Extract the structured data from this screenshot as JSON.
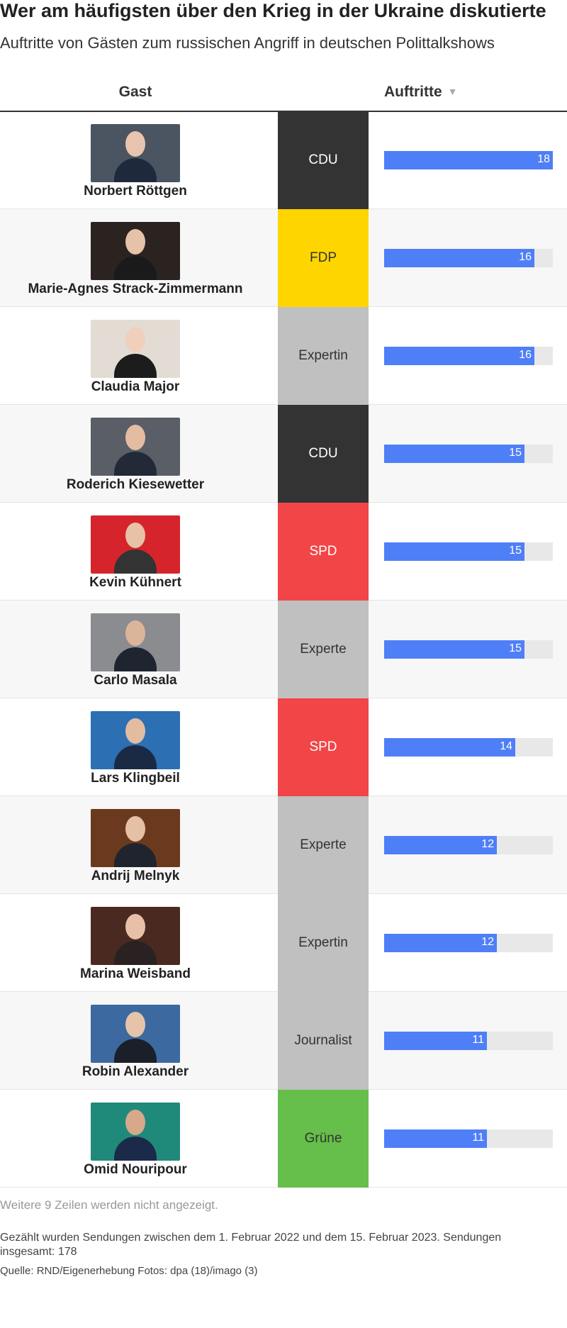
{
  "title": "Wer am häufigsten über den Krieg in der Ukraine diskutierte",
  "subtitle": "Auftritte von Gästen zum russischen Angriff in deutschen Polittalkshows",
  "header": {
    "guest_label": "Gast",
    "appearances_label": "Auftritte",
    "sort_icon": "sort-descending-icon"
  },
  "colors": {
    "bar": "#4f7ff7",
    "bar_track": "#e8e8e8",
    "CDU": "#333333",
    "FDP": "#ffd500",
    "SPD": "#f24548",
    "Grüne": "#66be4b",
    "neutral": "#c0c0c0"
  },
  "chart_data": {
    "type": "bar",
    "title": "Wer am häufigsten über den Krieg in der Ukraine diskutierte",
    "subtitle": "Auftritte von Gästen zum russischen Angriff in deutschen Polittalkshows",
    "xlabel": "",
    "ylabel": "Auftritte",
    "xlim": [
      0,
      18
    ],
    "categories": [
      "Norbert Röttgen",
      "Marie-Agnes Strack-Zimmermann",
      "Claudia Major",
      "Roderich Kiesewetter",
      "Kevin Kühnert",
      "Carlo Masala",
      "Lars Klingbeil",
      "Andrij Melnyk",
      "Marina Weisband",
      "Robin Alexander",
      "Omid Nouripour"
    ],
    "values": [
      18,
      16,
      16,
      15,
      15,
      15,
      14,
      12,
      12,
      11,
      11
    ],
    "rows": [
      {
        "name": "Norbert Röttgen",
        "party": "CDU",
        "value": 18
      },
      {
        "name": "Marie-Agnes Strack-Zimmermann",
        "party": "FDP",
        "value": 16
      },
      {
        "name": "Claudia Major",
        "party": "Expertin",
        "value": 16
      },
      {
        "name": "Roderich Kiesewetter",
        "party": "CDU",
        "value": 15
      },
      {
        "name": "Kevin Kühnert",
        "party": "SPD",
        "value": 15
      },
      {
        "name": "Carlo Masala",
        "party": "Experte",
        "value": 15
      },
      {
        "name": "Lars Klingbeil",
        "party": "SPD",
        "value": 14
      },
      {
        "name": "Andrij Melnyk",
        "party": "Experte",
        "value": 12
      },
      {
        "name": "Marina Weisband",
        "party": "Expertin",
        "value": 12
      },
      {
        "name": "Robin Alexander",
        "party": "Journalist",
        "value": 11
      },
      {
        "name": "Omid Nouripour",
        "party": "Grüne",
        "value": 11
      }
    ]
  },
  "note": "Weitere 9 Zeilen werden nicht angezeigt.",
  "footnote": "Gezählt wurden Sendungen zwischen dem 1. Februar 2022 und dem 15. Februar 2023. Sendungen insgesamt: 178",
  "source": "Quelle: RND/Eigenerhebung Fotos: dpa (18)/imago (3)"
}
